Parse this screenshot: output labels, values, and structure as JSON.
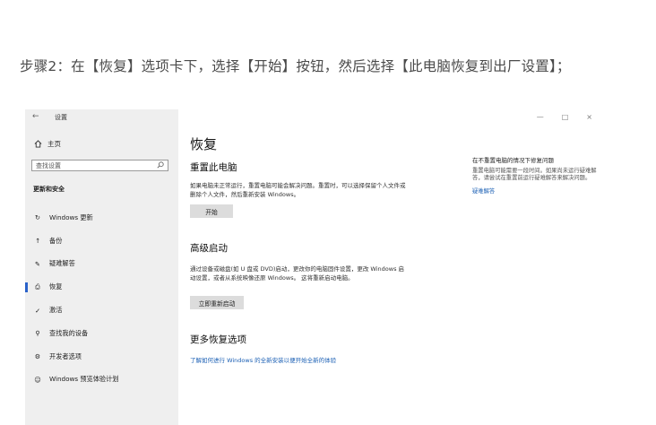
{
  "article": {
    "step_text": "步骤2：在【恢复】选项卡下，选择【开始】按钮，然后选择【此电脑恢复到出厂设置】；"
  },
  "window": {
    "back": "←",
    "title": "设置",
    "controls": {
      "minimize": "—",
      "maximize": "□",
      "close": "×"
    }
  },
  "sidebar": {
    "home_label": "主页",
    "search_placeholder": "查找设置",
    "section_title": "更新和安全",
    "items": [
      {
        "label": "Windows 更新",
        "icon": "sync-icon",
        "glyph": "↻"
      },
      {
        "label": "备份",
        "icon": "backup-icon",
        "glyph": "↑"
      },
      {
        "label": "疑难解答",
        "icon": "wrench-icon",
        "glyph": "✎"
      },
      {
        "label": "恢复",
        "icon": "recovery-icon",
        "glyph": "⎙",
        "active": true
      },
      {
        "label": "激活",
        "icon": "check-circle-icon",
        "glyph": "✓"
      },
      {
        "label": "查找我的设备",
        "icon": "find-device-icon",
        "glyph": "⚲"
      },
      {
        "label": "开发者选项",
        "icon": "developer-icon",
        "glyph": "⚙"
      },
      {
        "label": "Windows 预览体验计划",
        "icon": "insider-icon",
        "glyph": "☺"
      }
    ]
  },
  "main": {
    "page_title": "恢复",
    "reset": {
      "heading": "重置此电脑",
      "description": "如果电脑未正常运行，重置电脑可能会解决问题。重置时，可以选择保留个人文件或删除个人文件，然后重新安装 Windows。",
      "button": "开始"
    },
    "advanced": {
      "heading": "高级启动",
      "description": "通过设备或磁盘(如 U 盘或 DVD)启动，更改你的电脑固件设置，更改 Windows 启动设置，或者从系统映像还原 Windows。 这将重新启动电脑。",
      "button": "立即重新启动"
    },
    "more": {
      "heading": "更多恢复选项",
      "link": "了解如何进行 Windows 的全新安装以便开始全新的体验"
    },
    "aside": {
      "title": "在不重置电脑的情况下修复问题",
      "text": "重置电脑可能需要一段时间。如果尚未运行疑难解答，请尝试在重置前运行疑难解答来解决问题。",
      "link": "疑难解答"
    }
  },
  "colors": {
    "accent": "#2a62c9",
    "link": "#1a5fb4",
    "sidebar_bg": "#efefef"
  }
}
